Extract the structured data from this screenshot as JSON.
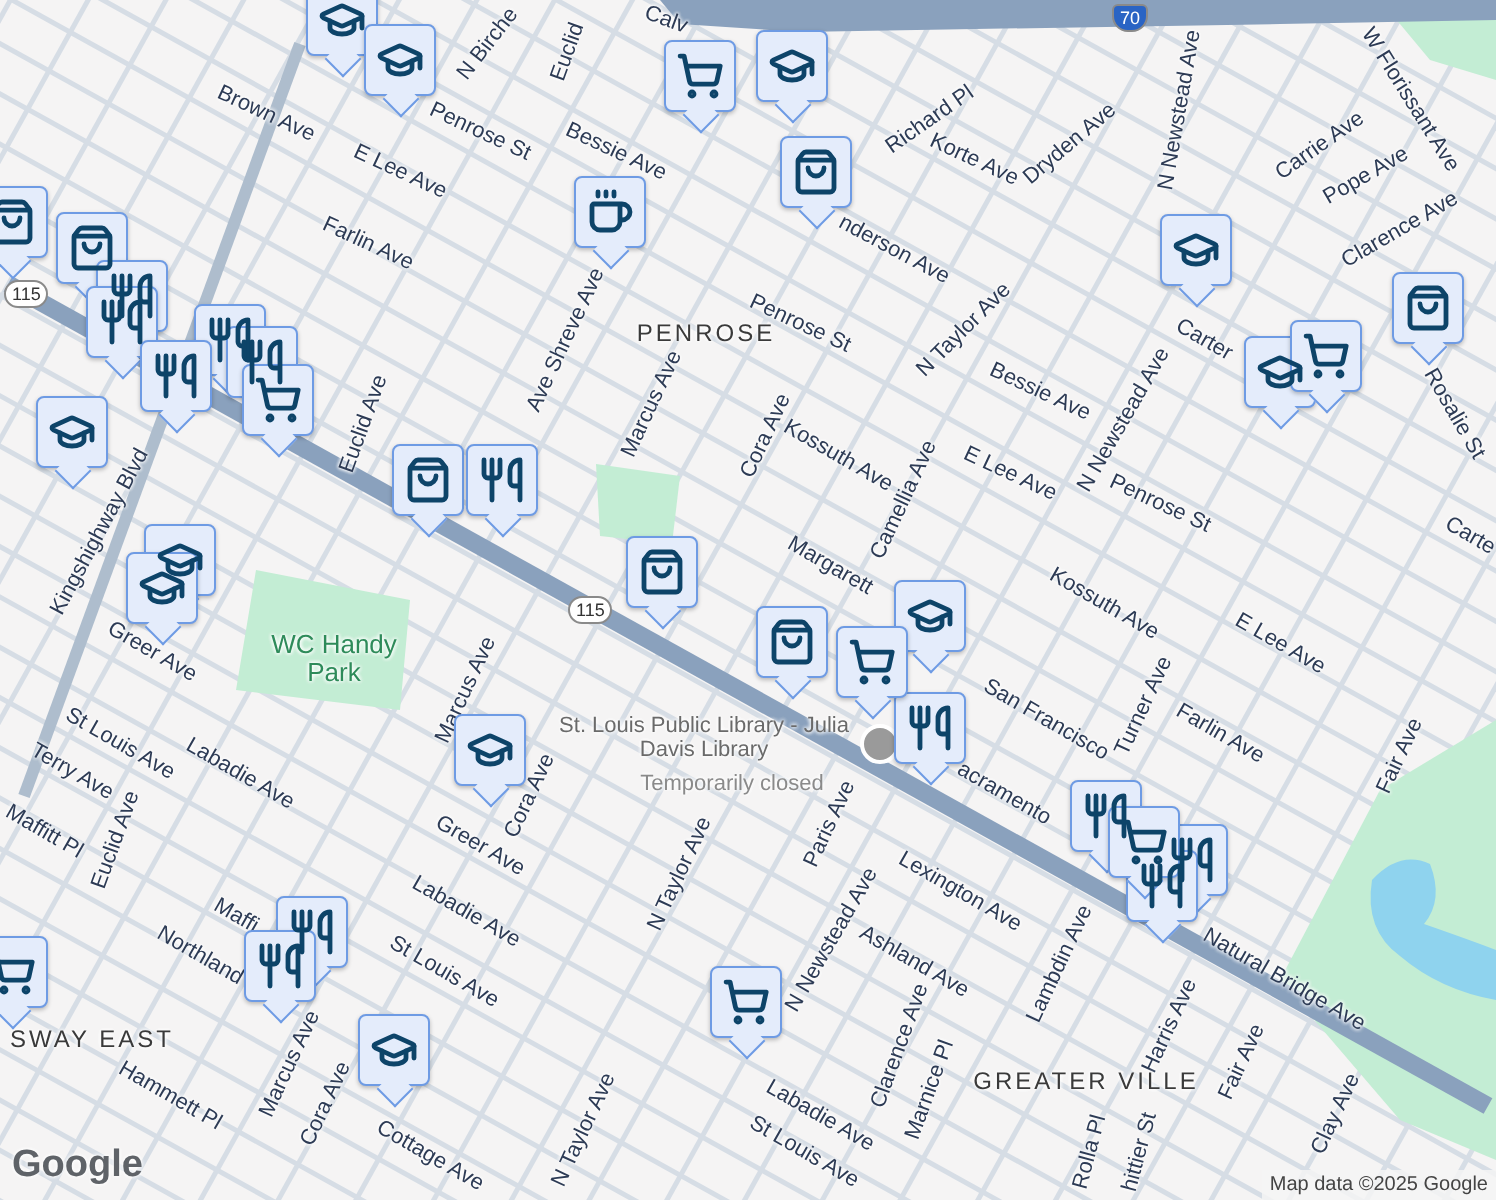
{
  "map": {
    "labels": [
      {
        "text": "Brown Ave",
        "kind": "street"
      },
      {
        "text": "N Birche",
        "kind": "street"
      },
      {
        "text": "Euclid",
        "kind": "street"
      },
      {
        "text": "Calv",
        "kind": "street"
      },
      {
        "text": "Penrose St",
        "kind": "street"
      },
      {
        "text": "Bessie Ave",
        "kind": "street"
      },
      {
        "text": "E Lee Ave",
        "kind": "street"
      },
      {
        "text": "Farlin Ave",
        "kind": "street"
      },
      {
        "text": "PENROSE",
        "kind": "area"
      },
      {
        "text": "Penrose St",
        "kind": "street"
      },
      {
        "text": "N Taylor Ave",
        "kind": "street"
      },
      {
        "text": "Bessie Ave",
        "kind": "street"
      },
      {
        "text": "nderson Ave",
        "kind": "street"
      },
      {
        "text": "Richard Pl",
        "kind": "street"
      },
      {
        "text": "Korte Ave",
        "kind": "street"
      },
      {
        "text": "Dryden Ave",
        "kind": "street"
      },
      {
        "text": "N Newstead Ave",
        "kind": "street"
      },
      {
        "text": "W Florissant Ave",
        "kind": "street"
      },
      {
        "text": "Carrie Ave",
        "kind": "street"
      },
      {
        "text": "Pope Ave",
        "kind": "street"
      },
      {
        "text": "Clarence Ave",
        "kind": "street"
      },
      {
        "text": "Carter",
        "kind": "street"
      },
      {
        "text": "Rosalie St",
        "kind": "street"
      },
      {
        "text": "N Newstead Ave",
        "kind": "street"
      },
      {
        "text": "Penrose St",
        "kind": "street"
      },
      {
        "text": "E Lee Ave",
        "kind": "street"
      },
      {
        "text": "Kossuth Ave",
        "kind": "street"
      },
      {
        "text": "Cora Ave",
        "kind": "street"
      },
      {
        "text": "Marcus Ave",
        "kind": "street"
      },
      {
        "text": "Ave Shreve Ave",
        "kind": "street"
      },
      {
        "text": "Euclid Ave",
        "kind": "street"
      },
      {
        "text": "Camellia Ave",
        "kind": "street"
      },
      {
        "text": "Margarett",
        "kind": "street"
      },
      {
        "text": "Kossuth Ave",
        "kind": "street"
      },
      {
        "text": "E Lee Ave",
        "kind": "street"
      },
      {
        "text": "Carte",
        "kind": "street"
      },
      {
        "text": "Farlin Ave",
        "kind": "street"
      },
      {
        "text": "Turner Ave",
        "kind": "street"
      },
      {
        "text": "San Francisco",
        "kind": "street"
      },
      {
        "text": "acramento",
        "kind": "street"
      },
      {
        "text": "Fair Ave",
        "kind": "street"
      },
      {
        "text": "Natural Bridge Ave",
        "kind": "street"
      },
      {
        "text": "Lexington Ave",
        "kind": "street"
      },
      {
        "text": "Paris Ave",
        "kind": "street"
      },
      {
        "text": "N Newstead Ave",
        "kind": "street"
      },
      {
        "text": "Ashland Ave",
        "kind": "street"
      },
      {
        "text": "Lambdin Ave",
        "kind": "street"
      },
      {
        "text": "Harris Ave",
        "kind": "street"
      },
      {
        "text": "Fair Ave",
        "kind": "street"
      },
      {
        "text": "Clarence Ave",
        "kind": "street"
      },
      {
        "text": "Marnice Pl",
        "kind": "street"
      },
      {
        "text": "GREATER VILLE",
        "kind": "area"
      },
      {
        "text": "Labadie Ave",
        "kind": "street"
      },
      {
        "text": "St Louis Ave",
        "kind": "street"
      },
      {
        "text": "Rolla Pl",
        "kind": "street"
      },
      {
        "text": "hittier St",
        "kind": "street"
      },
      {
        "text": "Clay Ave",
        "kind": "street"
      },
      {
        "text": "N Taylor Ave",
        "kind": "street"
      },
      {
        "text": "N Taylor Ave",
        "kind": "street"
      },
      {
        "text": "Cora Ave",
        "kind": "street"
      },
      {
        "text": "Marcus Ave",
        "kind": "street"
      },
      {
        "text": "Greer Ave",
        "kind": "street"
      },
      {
        "text": "Labadie Ave",
        "kind": "street"
      },
      {
        "text": "St Louis Ave",
        "kind": "street"
      },
      {
        "text": "Marcus Ave",
        "kind": "street"
      },
      {
        "text": "Cora Ave",
        "kind": "street"
      },
      {
        "text": "Cottage Ave",
        "kind": "street"
      },
      {
        "text": "Hammett Pl",
        "kind": "street"
      },
      {
        "text": "Northland",
        "kind": "street"
      },
      {
        "text": "Maffi",
        "kind": "street"
      },
      {
        "text": "SWAY EAST",
        "kind": "area"
      },
      {
        "text": "St Louis Ave",
        "kind": "street"
      },
      {
        "text": "Labadie Ave",
        "kind": "street"
      },
      {
        "text": "Terry Ave",
        "kind": "street"
      },
      {
        "text": "Euclid Ave",
        "kind": "street"
      },
      {
        "text": "Maffitt Pl",
        "kind": "street"
      },
      {
        "text": "Kingshighway Blvd",
        "kind": "street"
      },
      {
        "text": "Greer Ave",
        "kind": "street"
      },
      {
        "text": "WC Handy Park",
        "kind": "park"
      },
      {
        "text": "St. Louis Public Library - Julia Davis Library",
        "kind": "poi"
      },
      {
        "text": "Temporarily closed",
        "kind": "note"
      }
    ],
    "markers": [
      {
        "kind": "school"
      },
      {
        "kind": "school"
      },
      {
        "kind": "school"
      },
      {
        "kind": "school"
      },
      {
        "kind": "school"
      },
      {
        "kind": "school"
      },
      {
        "kind": "school"
      },
      {
        "kind": "school"
      },
      {
        "kind": "school"
      },
      {
        "kind": "school"
      },
      {
        "kind": "school"
      },
      {
        "kind": "shopping"
      },
      {
        "kind": "shopping"
      },
      {
        "kind": "shopping"
      },
      {
        "kind": "shopping"
      },
      {
        "kind": "shopping"
      },
      {
        "kind": "shopping"
      },
      {
        "kind": "shopping"
      },
      {
        "kind": "restaurant"
      },
      {
        "kind": "restaurant"
      },
      {
        "kind": "restaurant"
      },
      {
        "kind": "restaurant"
      },
      {
        "kind": "restaurant"
      },
      {
        "kind": "restaurant"
      },
      {
        "kind": "restaurant"
      },
      {
        "kind": "restaurant"
      },
      {
        "kind": "restaurant"
      },
      {
        "kind": "restaurant"
      },
      {
        "kind": "restaurant"
      },
      {
        "kind": "restaurant"
      },
      {
        "kind": "grocery"
      },
      {
        "kind": "grocery"
      },
      {
        "kind": "grocery"
      },
      {
        "kind": "grocery"
      },
      {
        "kind": "grocery"
      },
      {
        "kind": "grocery"
      },
      {
        "kind": "grocery"
      },
      {
        "kind": "cafe"
      }
    ],
    "shields": [
      {
        "kind": "state",
        "number": "115"
      },
      {
        "kind": "state",
        "number": "115"
      },
      {
        "kind": "interstate",
        "number": "70"
      }
    ],
    "logo": "Google",
    "attribution": "Map data ©2025 Google"
  }
}
